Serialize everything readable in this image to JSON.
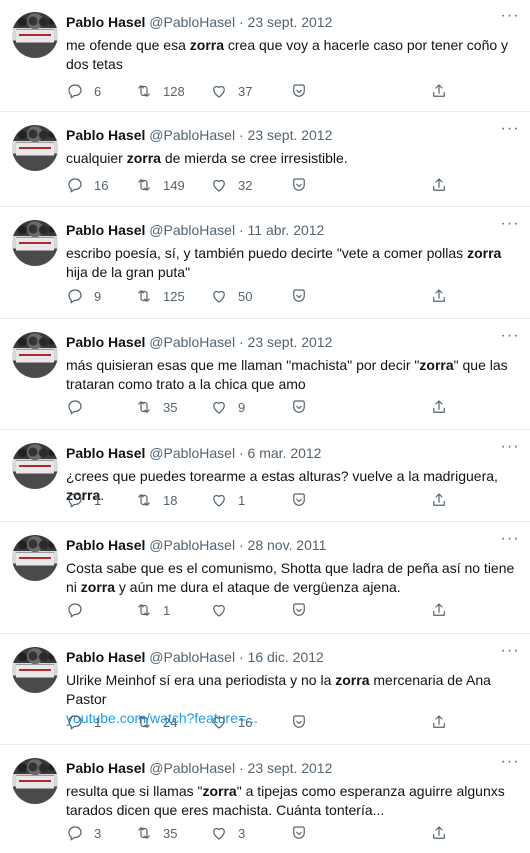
{
  "tweets": [
    {
      "name": "Pablo Hasel",
      "handle": "@PabloHasel",
      "date": "23 sept. 2012",
      "text_before": "me ofende que esa ",
      "text_bold": "zorra",
      "text_after": " crea que voy a hacerle caso por tener coño y dos tetas",
      "replies": "6",
      "retweets": "128",
      "likes": "37"
    },
    {
      "name": "Pablo Hasel",
      "handle": "@PabloHasel",
      "date": "23 sept. 2012",
      "text_before": "cualquier ",
      "text_bold": "zorra",
      "text_after": " de mierda se cree irresistible.",
      "replies": "16",
      "retweets": "149",
      "likes": "32"
    },
    {
      "name": "Pablo Hasel",
      "handle": "@PabloHasel",
      "date": "11 abr. 2012",
      "text_before": "escribo poesía, sí, y también puedo decirte \"vete a comer pollas ",
      "text_bold": "zorra",
      "text_after": " hija de la gran puta\"",
      "replies": "9",
      "retweets": "125",
      "likes": "50"
    },
    {
      "name": "Pablo Hasel",
      "handle": "@PabloHasel",
      "date": "23 sept. 2012",
      "text_before": "más quisieran esas que me llaman \"machista\" por decir \"",
      "text_bold": "zorra",
      "text_after": "\" que las trataran como trato a la chica que amo",
      "replies": "",
      "retweets": "35",
      "likes": "9"
    },
    {
      "name": "Pablo Hasel",
      "handle": "@PabloHasel",
      "date": "6 mar. 2012",
      "text_before": "¿crees que puedes torearme a estas alturas? vuelve a la madriguera, ",
      "text_bold": "zorra",
      "text_after": ".",
      "replies": "1",
      "retweets": "18",
      "likes": "1"
    },
    {
      "name": "Pablo Hasel",
      "handle": "@PabloHasel",
      "date": "28 nov. 2011",
      "text_before": "Costa sabe que es el comunismo, Shotta que ladra de peña así no tiene ni ",
      "text_bold": "zorra",
      "text_after": " y aún me dura el ataque de vergüenza ajena.",
      "replies": "",
      "retweets": "1",
      "likes": ""
    },
    {
      "name": "Pablo Hasel",
      "handle": "@PabloHasel",
      "date": "16 dic. 2012",
      "text_before": "Ulrike Meinhof sí era una periodista y no la ",
      "text_bold": "zorra",
      "text_after": " mercenaria de Ana Pastor",
      "link": "youtube.com/watch?feature=...",
      "replies": "1",
      "retweets": "24",
      "likes": "16"
    },
    {
      "name": "Pablo Hasel",
      "handle": "@PabloHasel",
      "date": "23 sept. 2012",
      "text_before": "resulta que si llamas \"",
      "text_bold": "zorra",
      "text_after": "\" a tipejas como esperanza aguirre algunxs tarados dicen que eres machista. Cuánta tontería...",
      "replies": "3",
      "retweets": "35",
      "likes": "3"
    }
  ],
  "icons": {
    "reply": "reply-icon",
    "retweet": "retweet-icon",
    "like": "heart-icon",
    "save": "bookmark-icon",
    "share": "share-icon",
    "more": "more-icon"
  }
}
